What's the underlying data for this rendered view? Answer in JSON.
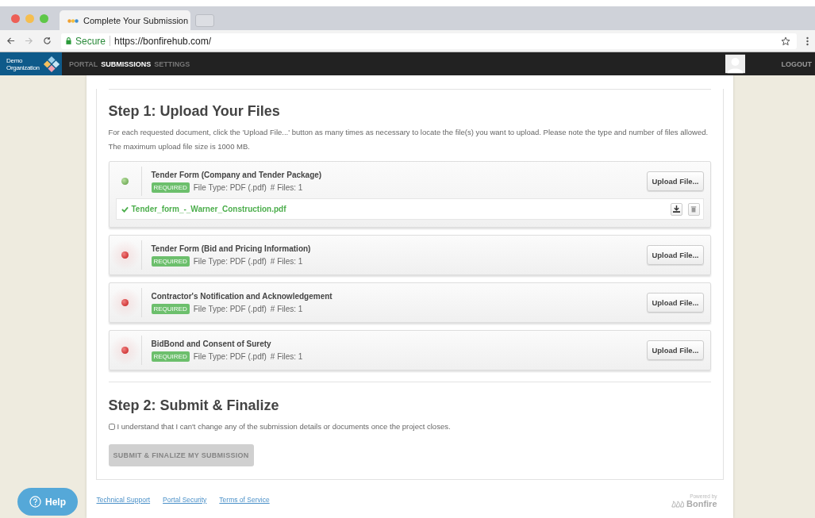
{
  "browser": {
    "tab_title": "Complete Your Submission",
    "secure_label": "Secure",
    "url": "https://bonfirehub.com/"
  },
  "nav": {
    "org": "Demo Organization",
    "items": [
      {
        "label": "PORTAL",
        "selected": false
      },
      {
        "label": "SUBMISSIONS",
        "selected": true
      },
      {
        "label": "SETTINGS",
        "selected": false
      }
    ],
    "logout": "LOGOUT"
  },
  "step1": {
    "title": "Step 1: Upload Your Files",
    "description": "For each requested document, click the 'Upload File...' button as many times as necessary to locate the file(s) you want to upload. Please note the type and number of files allowed. The maximum upload file size is 1000 MB."
  },
  "documents": [
    {
      "title": "Tender Form (Company and Tender Package)",
      "badge": "REQUIRED",
      "file_type": "File Type: PDF (.pdf)",
      "files_count": "# Files: 1",
      "uploaded": true,
      "button": "Upload File...",
      "files": [
        {
          "name": "Tender_form_-_Warner_Construction.pdf"
        }
      ]
    },
    {
      "title": "Tender Form (Bid and Pricing Information)",
      "badge": "REQUIRED",
      "file_type": "File Type: PDF (.pdf)",
      "files_count": "# Files: 1",
      "uploaded": false,
      "button": "Upload File..."
    },
    {
      "title": "Contractor's Notification and Acknowledgement",
      "badge": "REQUIRED",
      "file_type": "File Type: PDF (.pdf)",
      "files_count": "# Files: 1",
      "uploaded": false,
      "button": "Upload File..."
    },
    {
      "title": "BidBond and Consent of Surety",
      "badge": "REQUIRED",
      "file_type": "File Type: PDF (.pdf)",
      "files_count": "# Files: 1",
      "uploaded": false,
      "button": "Upload File..."
    }
  ],
  "step2": {
    "title": "Step 2: Submit & Finalize",
    "checkbox": {
      "label": "I understand that I can't change any of the submission details or documents once the project closes.",
      "checked": false
    },
    "submit": {
      "label": "SUBMIT & FINALIZE MY SUBMISSION",
      "disabled": true
    }
  },
  "footer": {
    "links": [
      "Technical Support",
      "Portal Security",
      "Terms of Service"
    ],
    "powered_by": "Powered by",
    "brand": "Bonfire"
  },
  "help": "Help"
}
